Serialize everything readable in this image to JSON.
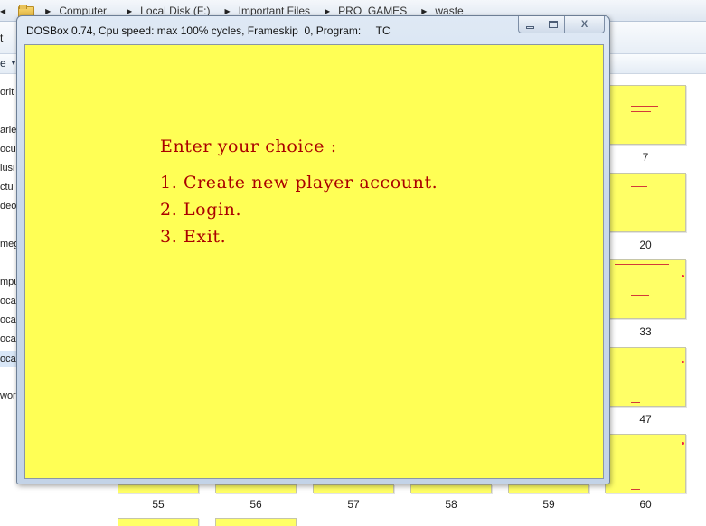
{
  "explorer": {
    "breadcrumbs": [
      "Computer",
      "Local Disk (F:)",
      "Important Files",
      "PRO_GAMES",
      "waste"
    ],
    "toolbar": {
      "organize_partial": "e",
      "left_edge": "t"
    },
    "nav_items": [
      "orit",
      "arie",
      "ocu",
      "lusi",
      "ctu",
      "deo",
      "meg",
      "mpu",
      "ocal",
      "ocal",
      "ocal",
      "ocal",
      "wor"
    ],
    "thumbnails": [
      "7",
      "20",
      "33",
      "47",
      "55",
      "56",
      "57",
      "58",
      "59",
      "60"
    ]
  },
  "dosbox": {
    "title": "DOSBox 0.74, Cpu speed: max 100% cycles, Frameskip  0, Program:     TC",
    "buttons": {
      "close": "X"
    },
    "screen": {
      "prompt": "Enter your choice :",
      "options": [
        "1. Create new player account.",
        "2. Login.",
        "3. Exit."
      ]
    },
    "colors": {
      "screen_bg": "#ffff55",
      "text": "#aa0000"
    }
  }
}
